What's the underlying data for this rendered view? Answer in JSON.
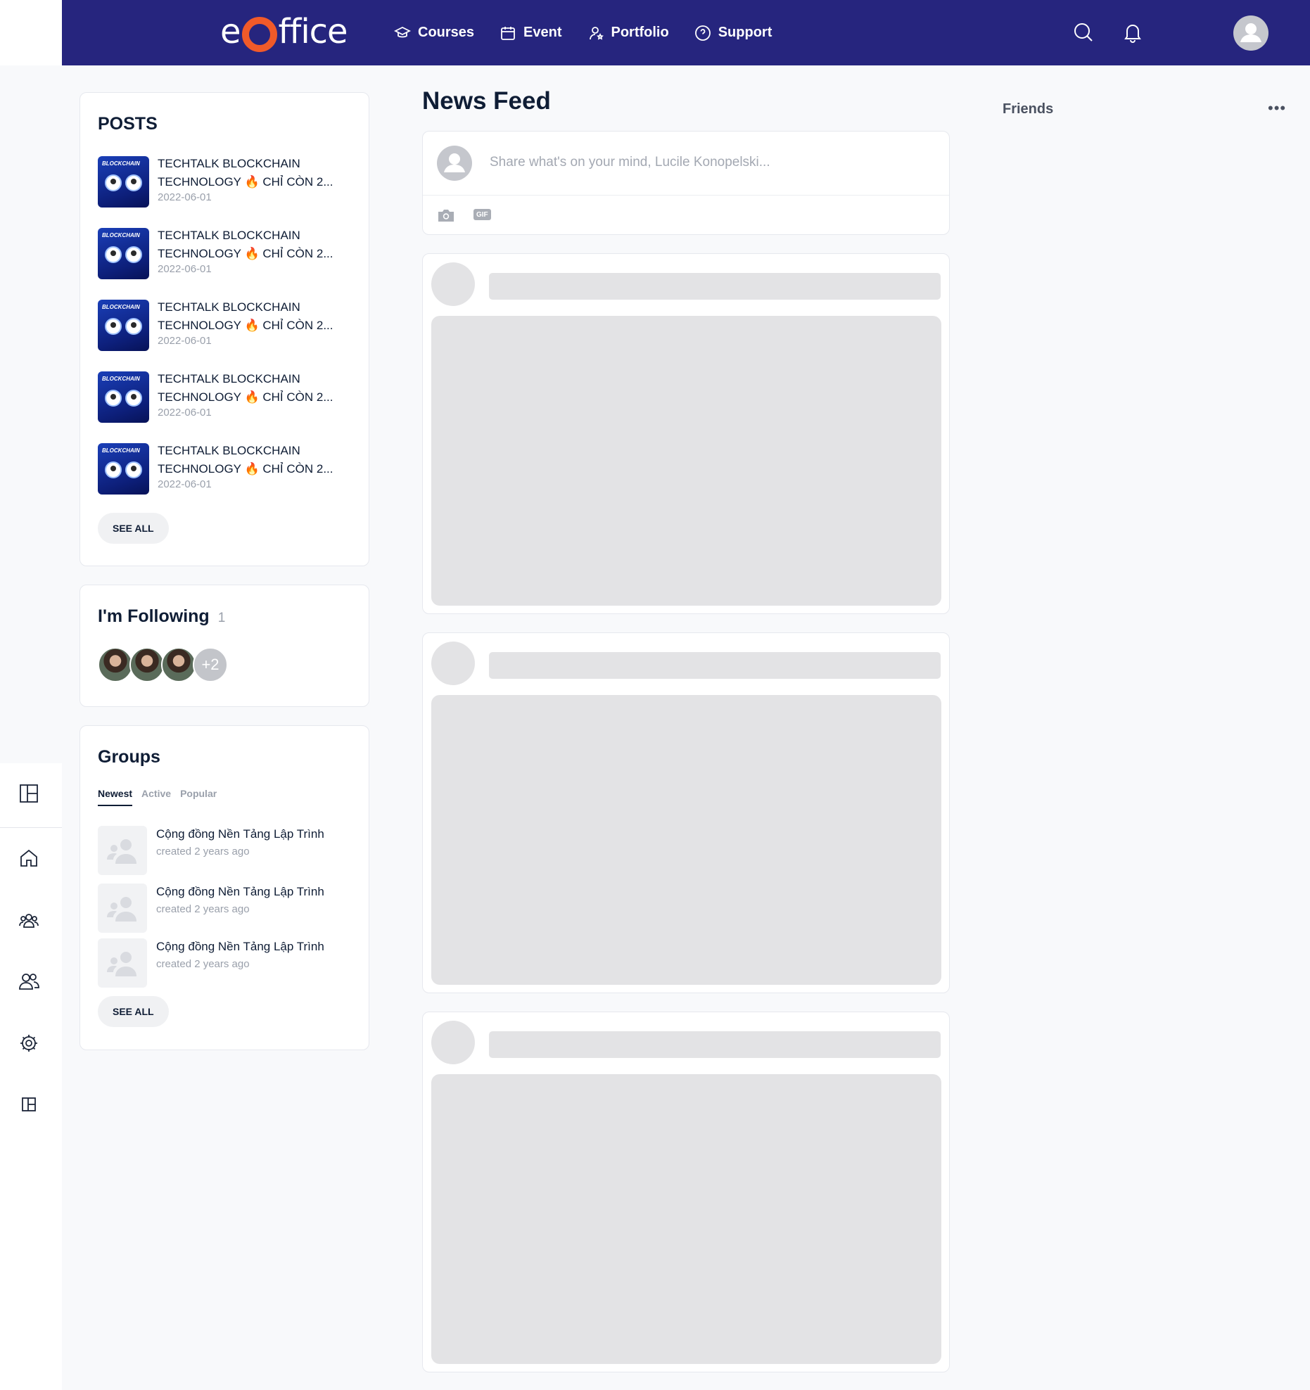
{
  "header": {
    "logo_prefix": "e",
    "logo_suffix": "ffice",
    "nav": [
      {
        "label": "Courses",
        "icon": "graduation-cap-icon"
      },
      {
        "label": "Event",
        "icon": "calendar-icon"
      },
      {
        "label": "Portfolio",
        "icon": "user-star-icon"
      },
      {
        "label": "Support",
        "icon": "help-circle-icon"
      }
    ],
    "actions": [
      "search-icon",
      "bell-icon",
      "user-avatar"
    ]
  },
  "rail": {
    "items": [
      "layout-icon",
      "home-icon",
      "groups-icon",
      "friends-icon",
      "settings-icon",
      "panel-icon"
    ]
  },
  "posts": {
    "title": "POSTS",
    "items": [
      {
        "line1": "TECHTALK BLOCKCHAIN",
        "line2a": "TECHNOLOGY",
        "fire": "🔥",
        "line2b": "CHỈ CÒN 2...",
        "date": "2022-06-01",
        "thumb_text": "BLOCKCHAIN"
      },
      {
        "line1": "TECHTALK BLOCKCHAIN",
        "line2a": "TECHNOLOGY",
        "fire": "🔥",
        "line2b": "CHỈ CÒN 2...",
        "date": "2022-06-01",
        "thumb_text": "BLOCKCHAIN"
      },
      {
        "line1": "TECHTALK BLOCKCHAIN",
        "line2a": "TECHNOLOGY",
        "fire": "🔥",
        "line2b": "CHỈ CÒN 2...",
        "date": "2022-06-01",
        "thumb_text": "BLOCKCHAIN"
      },
      {
        "line1": "TECHTALK BLOCKCHAIN",
        "line2a": "TECHNOLOGY",
        "fire": "🔥",
        "line2b": "CHỈ CÒN 2...",
        "date": "2022-06-01",
        "thumb_text": "BLOCKCHAIN"
      },
      {
        "line1": "TECHTALK BLOCKCHAIN",
        "line2a": "TECHNOLOGY",
        "fire": "🔥",
        "line2b": "CHỈ CÒN 2...",
        "date": "2022-06-01",
        "thumb_text": "BLOCKCHAIN"
      }
    ],
    "see_all": "SEE ALL"
  },
  "following": {
    "title": "I'm Following",
    "count": "1",
    "more": "+2"
  },
  "groups": {
    "title": "Groups",
    "tabs": [
      {
        "label": "Newest",
        "active": true
      },
      {
        "label": "Active",
        "active": false
      },
      {
        "label": "Popular",
        "active": false
      }
    ],
    "items": [
      {
        "name": "Cộng đồng Nền Tảng Lập Trình",
        "meta": "created 2 years ago"
      },
      {
        "name": "Cộng đồng Nền Tảng Lập Trình",
        "meta": "created 2 years ago"
      },
      {
        "name": "Cộng đồng Nền Tảng Lập Trình",
        "meta": "created 2 years ago"
      }
    ],
    "see_all": "SEE ALL"
  },
  "feed": {
    "title": "News Feed",
    "composer_placeholder": "Share what's on your mind, Lucile Konopelski...",
    "tools": [
      "camera-icon",
      "GIF"
    ],
    "skeleton_count": 3
  },
  "friends": {
    "title": "Friends",
    "more": "•••"
  },
  "colors": {
    "topbar": "#26257e",
    "brand_accent": "#f15a29",
    "background": "#f8f9fb",
    "skeleton": "#e3e3e5"
  }
}
